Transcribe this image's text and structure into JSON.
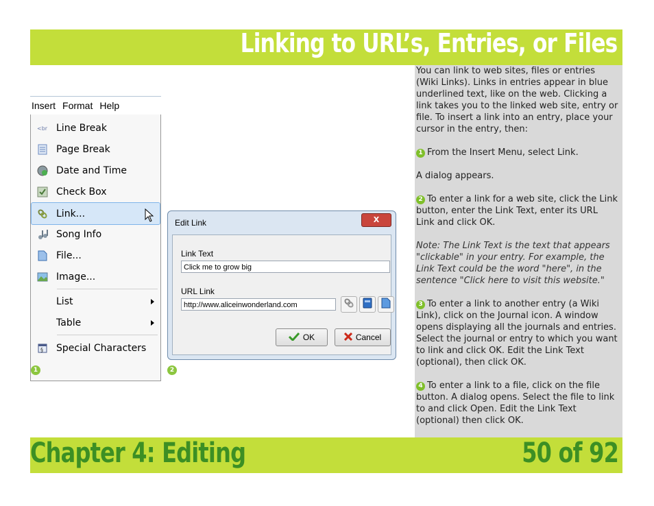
{
  "header": {
    "title": "Linking to URL’s, Entries, or Files"
  },
  "footer": {
    "chapter": "Chapter 4: Editing",
    "page": "50 of 92"
  },
  "menu": {
    "bar": [
      "Insert",
      "Format",
      "Help"
    ],
    "items": [
      {
        "label": "Line Break",
        "icon": "line-break-icon"
      },
      {
        "label": "Page Break",
        "icon": "page-break-icon"
      },
      {
        "label": "Date and Time",
        "icon": "clock-icon"
      },
      {
        "label": "Check Box",
        "icon": "checkbox-icon"
      },
      {
        "label": "Link...",
        "icon": "link-icon",
        "highlighted": true
      },
      {
        "label": "Song Info",
        "icon": "music-icon"
      },
      {
        "label": "File...",
        "icon": "file-icon"
      },
      {
        "label": "Image...",
        "icon": "image-icon"
      },
      {
        "label": "List",
        "submenu": true
      },
      {
        "label": "Table",
        "submenu": true
      },
      {
        "label": "Special Characters",
        "icon": "special-characters-icon"
      }
    ]
  },
  "dialog": {
    "title": "Edit Link",
    "close": "X",
    "link_text_label": "Link Text",
    "link_text_value": "Click me to grow big",
    "url_label": "URL Link",
    "url_value": "http://www.aliceinwonderland.com",
    "ok": "OK",
    "cancel": "Cancel"
  },
  "badges": {
    "one": "1",
    "two": "2",
    "three": "3",
    "four": "4"
  },
  "text": {
    "intro": "You can link to web sites, files or entries (Wiki Links). Links in entries appear in blue underlined text, like on the web. Clicking a link takes you to the linked web site, entry or file. To insert a link into an entry, place your cursor in the entry, then:",
    "step1": "From the Insert Menu, select Link.",
    "dialog_appears": "A dialog appears.",
    "step2": "To enter a link for a web site, click the Link button, enter the Link Text, enter its URL Link and click OK.",
    "note": "Note: The Link Text is the text that appears \"clickable\" in your entry.  For example, the Link Text could be the word \"here\", in the sentence \"Click here to visit this website.\"",
    "step3": "To enter a link to another entry (a Wiki Link), click on the Journal icon.  A window opens displaying all the journals and entries. Select the journal or entry to which you want to link and click OK. Edit the Link Text (optional), then click OK.",
    "step4": "To enter a link to a file, click on the file button.  A dialog opens. Select the file to link to and click Open. Edit the Link Text (optional) then click OK."
  },
  "colors": {
    "band": "#c3de3a",
    "chapter_text": "#3c8f24",
    "panel": "#d9d9d9",
    "badge": "#8cc63f"
  }
}
